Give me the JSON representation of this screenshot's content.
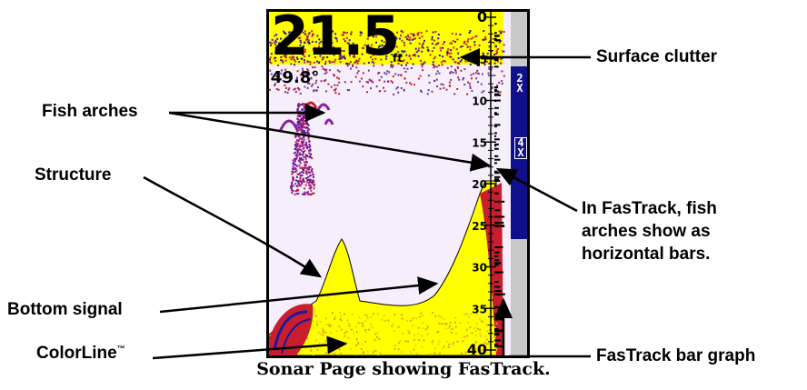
{
  "sonar": {
    "depth_reading": "21.5",
    "depth_unit": "ft",
    "temperature": "49.8°",
    "depth_scale": [
      "0",
      "5",
      "10",
      "15",
      "20",
      "25",
      "30",
      "35",
      "40"
    ],
    "zoom_labels": [
      "2\nX",
      "4\nX"
    ]
  },
  "callouts": {
    "surface_clutter": "Surface clutter",
    "fish_arches": "Fish arches",
    "structure": "Structure",
    "fastrack_note": "In FasTrack, fish arches show as horizontal bars.",
    "bottom_signal": "Bottom signal",
    "colorline": "ColorLine",
    "colorline_tm": "™",
    "fastrack_bar_graph": "FasTrack bar  graph"
  },
  "caption": "Sonar Page showing FasTrack.",
  "colors": {
    "bottom": "#ffff00",
    "clutter_red": "#c81e2e",
    "clutter_blue": "#2a1a9a",
    "zoom_bar": "#10108a",
    "side_panel": "#c8c8c8"
  }
}
